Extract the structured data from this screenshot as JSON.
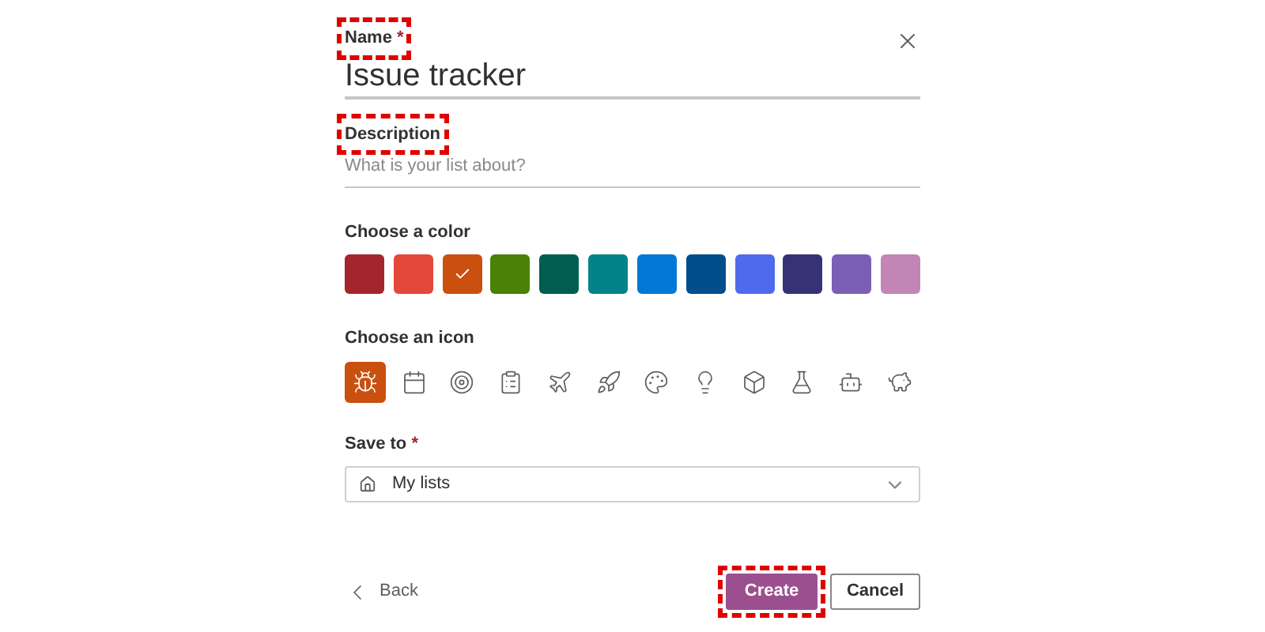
{
  "name_field": {
    "label": "Name",
    "required_mark": "*",
    "value": "Issue tracker",
    "highlighted": true
  },
  "description_field": {
    "label": "Description",
    "placeholder": "What is your list about?",
    "highlighted": true
  },
  "color_section": {
    "title": "Choose a color",
    "colors": [
      {
        "color": "#a4262c",
        "selected": false
      },
      {
        "color": "#e3483a",
        "selected": false
      },
      {
        "color": "#ca5010",
        "selected": true
      },
      {
        "color": "#498205",
        "selected": false
      },
      {
        "color": "#005e50",
        "selected": false
      },
      {
        "color": "#038387",
        "selected": false
      },
      {
        "color": "#0078d4",
        "selected": false
      },
      {
        "color": "#004e8c",
        "selected": false
      },
      {
        "color": "#4f6bed",
        "selected": false
      },
      {
        "color": "#373277",
        "selected": false
      },
      {
        "color": "#7a5fb5",
        "selected": false
      },
      {
        "color": "#c385b6",
        "selected": false
      }
    ]
  },
  "icon_section": {
    "title": "Choose an icon",
    "icons": [
      {
        "kind": "bug",
        "selected": true
      },
      {
        "kind": "calendar",
        "selected": false
      },
      {
        "kind": "target",
        "selected": false
      },
      {
        "kind": "clipboard",
        "selected": false
      },
      {
        "kind": "plane",
        "selected": false
      },
      {
        "kind": "rocket",
        "selected": false
      },
      {
        "kind": "palette",
        "selected": false
      },
      {
        "kind": "lightbulb",
        "selected": false
      },
      {
        "kind": "box",
        "selected": false
      },
      {
        "kind": "flask",
        "selected": false
      },
      {
        "kind": "robot",
        "selected": false
      },
      {
        "kind": "piggybank",
        "selected": false
      }
    ]
  },
  "save_to": {
    "label": "Save to",
    "required_mark": "*",
    "value": "My lists"
  },
  "footer": {
    "back": "Back",
    "create": {
      "label": "Create",
      "highlighted": true
    },
    "cancel": "Cancel"
  }
}
